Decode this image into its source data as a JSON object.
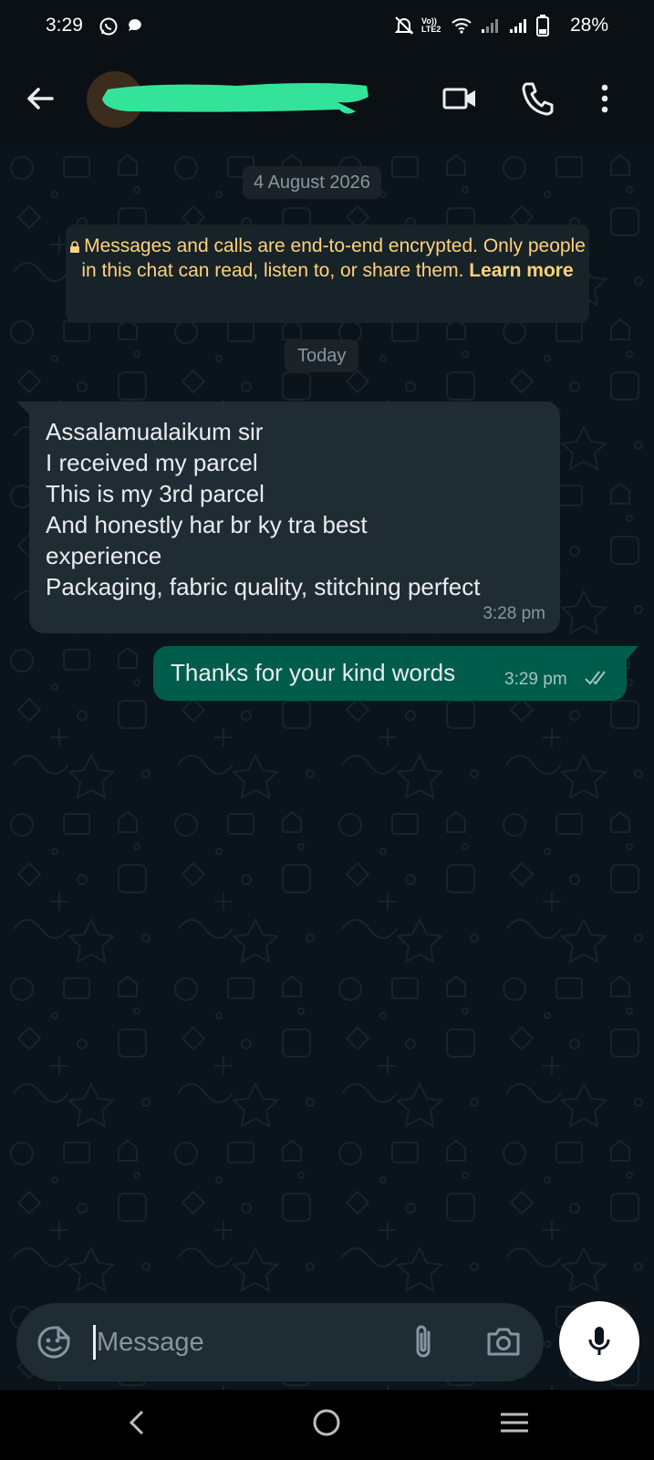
{
  "status_bar": {
    "time": "3:29",
    "battery": "28%",
    "network_label": "Vo)) LTE2",
    "left_icons": [
      "whatsapp-icon",
      "chat-bubble-icon"
    ],
    "right_icons": [
      "bell-off-icon",
      "volte-icon",
      "wifi-icon",
      "signal-icon",
      "signal-icon",
      "battery-icon"
    ]
  },
  "header": {
    "contact_name": "",
    "icons": [
      "back-arrow-icon",
      "video-call-icon",
      "phone-icon",
      "more-vertical-icon"
    ]
  },
  "chat": {
    "date_chip": "4 August 2026",
    "encryption_notice": "Messages and calls are end-to-end encrypted. Only people in this chat can read, listen to, or share them.",
    "encryption_link": "Learn more",
    "today_chip": "Today",
    "messages": [
      {
        "direction": "incoming",
        "text": "Assalamualaikum sir\nI received my parcel\nThis is my 3rd parcel\nAnd honestly har  br ky tra best\nexperience\nPackaging, fabric quality, stitching perfect",
        "time": "3:28 pm"
      },
      {
        "direction": "outgoing",
        "text": "Thanks for your kind words",
        "time": "3:29 pm",
        "status": "read"
      }
    ]
  },
  "composer": {
    "placeholder": "Message",
    "icons": [
      "emoji-sticker-icon",
      "paperclip-icon",
      "camera-icon",
      "microphone-icon"
    ]
  },
  "nav_bar": {
    "icons": [
      "nav-back-icon",
      "nav-home-icon",
      "nav-recents-icon"
    ]
  },
  "colors": {
    "background": "#0b141a",
    "incoming_bubble": "#202c33",
    "outgoing_bubble": "#005c4b",
    "encryption_text": "#ffd279",
    "redaction": "#33e39a"
  }
}
